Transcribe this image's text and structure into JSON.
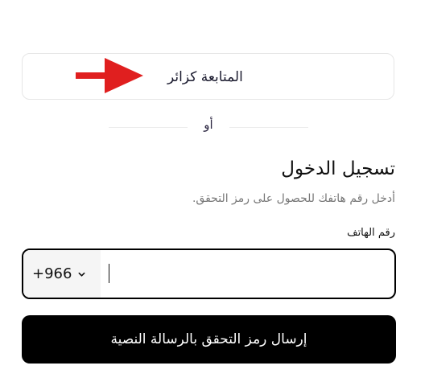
{
  "guest": {
    "label": "المتابعة كزائر"
  },
  "divider": {
    "or_text": "أو"
  },
  "login": {
    "title": "تسجيل الدخول",
    "subtitle": "أدخل رقم هاتفك للحصول على رمز التحقق.",
    "phone_label": "رقم الهاتف"
  },
  "phone": {
    "country_code": "+966",
    "value": "",
    "placeholder": ""
  },
  "send_button": {
    "label": "إرسال رمز التحقق بالرسالة النصية"
  },
  "colors": {
    "arrow": "#e01f1f",
    "primary_button": "#000000",
    "input_border": "#000000",
    "country_bg": "#f5f5f5"
  },
  "icons": {
    "annotation": "arrow-right-icon",
    "dropdown": "chevron-down-icon"
  }
}
